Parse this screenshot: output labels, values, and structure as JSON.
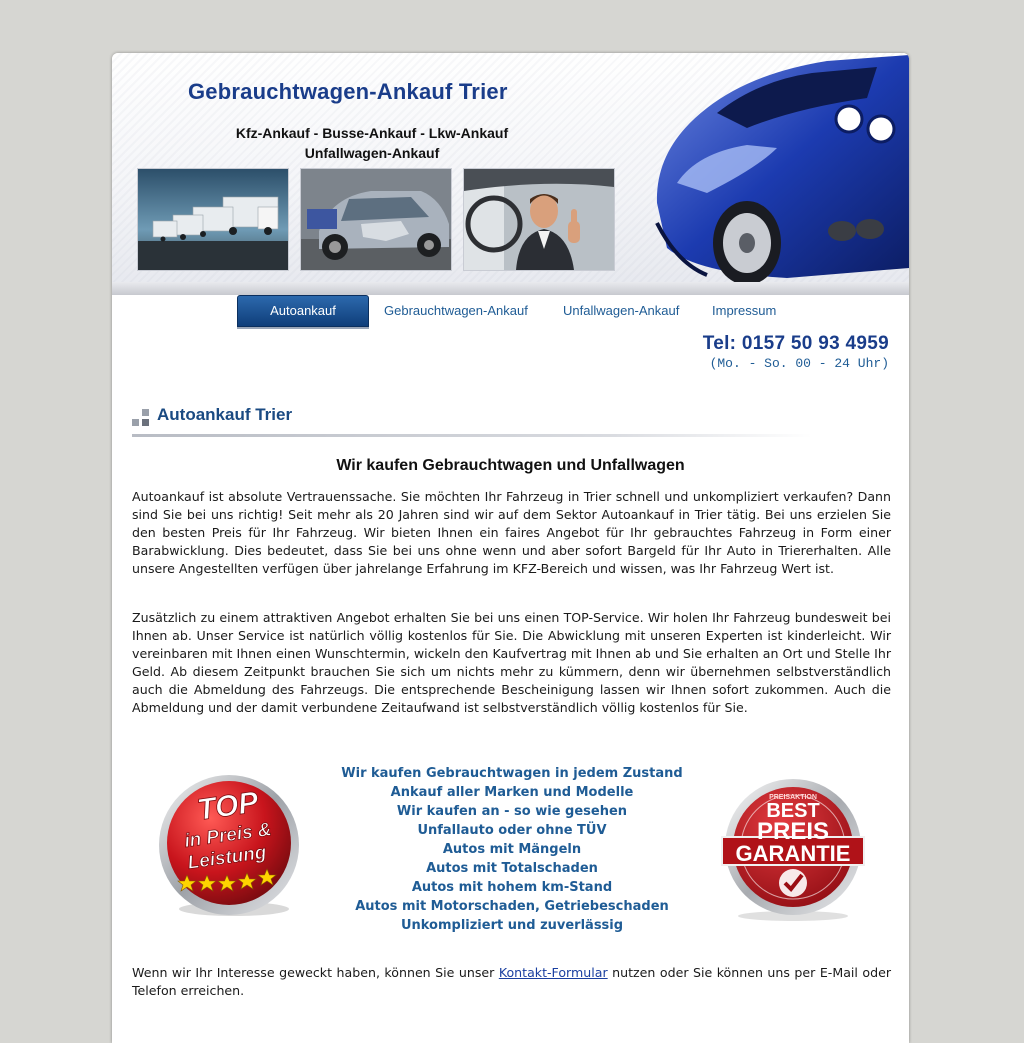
{
  "header": {
    "site_title": "Gebrauchtwagen-Ankauf Trier",
    "tagline_line1": "Kfz-Ankauf - Busse-Ankauf - Lkw-Ankauf",
    "tagline_line2": "Unfallwagen-Ankauf"
  },
  "nav": {
    "items": [
      {
        "label": "Autoankauf",
        "active": true
      },
      {
        "label": "Gebrauchtwagen-Ankauf",
        "active": false
      },
      {
        "label": "Unfallwagen-Ankauf",
        "active": false
      },
      {
        "label": "Impressum",
        "active": false
      }
    ]
  },
  "contact": {
    "phone": "Tel: 0157 50 93 4959",
    "hours": "(Mo. - So. 00 - 24 Uhr)"
  },
  "section": {
    "title": "Autoankauf Trier"
  },
  "content": {
    "heading": "Wir kaufen Gebrauchtwagen und Unfallwagen",
    "paragraph1": "Autoankauf ist absolute Vertrauenssache. Sie möchten Ihr Fahrzeug in Trier schnell und unkompliziert verkaufen? Dann sind Sie bei uns richtig! Seit mehr als 20 Jahren sind wir auf dem Sektor Autoankauf in Trier tätig. Bei uns erzielen Sie den besten Preis für Ihr Fahrzeug. Wir bieten Ihnen ein faires Angebot für Ihr gebrauchtes Fahrzeug in Form einer Barabwicklung. Dies bedeutet, dass Sie bei uns ohne wenn und aber sofort Bargeld für Ihr Auto in Triererhalten. Alle unsere Angestellten verfügen über jahrelange Erfahrung im KFZ-Bereich und wissen, was Ihr Fahrzeug Wert ist.",
    "paragraph2": "Zusätzlich zu einem attraktiven Angebot erhalten Sie bei uns einen TOP-Service. Wir holen Ihr Fahrzeug bundesweit bei Ihnen ab. Unser Service ist natürlich völlig kostenlos für Sie. Die Abwicklung mit unseren Experten ist kinderleicht. Wir vereinbaren mit Ihnen einen Wunschtermin, wickeln den Kaufvertrag mit Ihnen ab und Sie erhalten an Ort und Stelle Ihr Geld. Ab diesem Zeitpunkt brauchen Sie sich um nichts mehr zu kümmern, denn wir übernehmen selbstverständlich auch die Abmeldung des Fahrzeugs. Die entsprechende Bescheinigung lassen wir Ihnen sofort zukommen. Auch die Abmeldung und der damit verbundene Zeitaufwand ist selbstverständlich völlig kostenlos für Sie.",
    "features": [
      "Wir kaufen Gebrauchtwagen in jedem Zustand",
      "Ankauf aller Marken und Modelle",
      "Wir kaufen an - so wie gesehen",
      "Unfallauto oder ohne TÜV",
      "Autos mit Mängeln",
      "Autos mit Totalschaden",
      "Autos mit hohem km-Stand",
      "Autos mit Motorschaden, Getriebeschaden",
      "Unkompliziert und zuverlässig"
    ],
    "footer_before": "Wenn wir Ihr Interesse geweckt haben, können Sie unser ",
    "footer_link": "Kontakt-Formular",
    "footer_after": " nutzen oder Sie können uns per E-Mail oder Telefon erreichen."
  },
  "badges": {
    "top_line1": "TOP",
    "top_line2": "in Preis &",
    "top_line3": "Leistung",
    "best_line1": "BEST",
    "best_line2": "PREIS",
    "best_line3": "GARANTIE",
    "best_ring": "PREISAKTION"
  },
  "colors": {
    "brand_blue": "#1a3d8a",
    "link_blue": "#1f5c95",
    "badge_red": "#c8141c"
  }
}
